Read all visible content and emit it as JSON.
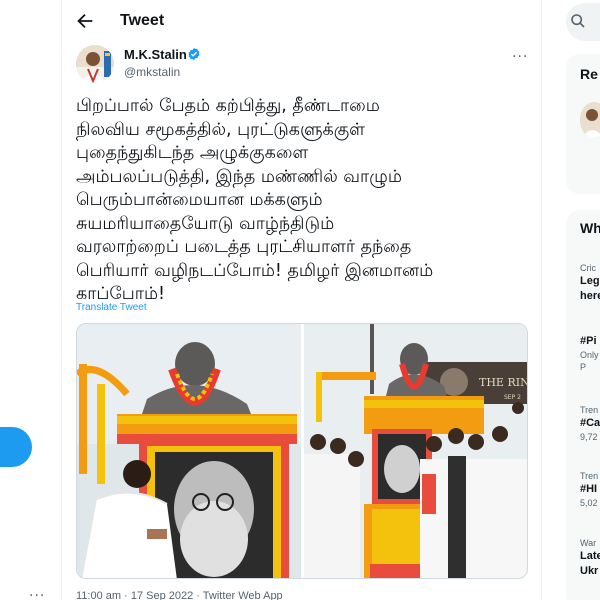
{
  "header": {
    "title": "Tweet"
  },
  "author": {
    "name": "M.K.Stalin",
    "handle": "@mkstalin"
  },
  "tweet": {
    "text": "பிறப்பால் பேதம் கற்பித்து, தீண்டாமை\nநிலவிய சமூகத்தில், புரட்டுகளுக்குள்\nபுதைந்துகிடந்த அழுக்குகளை\nஅம்பலப்படுத்தி, இந்த மண்ணில் வாழும்\nபெரும்பான்மையான மக்களும்\nசுயமரியாதையோடு வாழ்ந்திடும்\nவரலாற்றைப் படைத்த புரட்சியாளர் தந்தை\nபெரியார் வழிநடப்போம்! தமிழர் இனமானம்\nகாப்போம்!",
    "translate": "Translate Tweet",
    "timestamp": "11:00 am · 17 Sep 2022 · Twitter Web App"
  },
  "media": {
    "billboard_text": "THE RINGS",
    "billboard_sub": "SEP 2"
  },
  "sidebar": {
    "relevant_title": "Re",
    "trends_title": "Wh",
    "trends": [
      {
        "meta": "Cric",
        "name": "Leg",
        "name2": "here",
        "count": ""
      },
      {
        "meta": "",
        "name": "#Pi",
        "name2": "Only",
        "count": "P"
      },
      {
        "meta": "Tren",
        "name": "#Ca",
        "name2": "",
        "count": "9,72"
      },
      {
        "meta": "Tren",
        "name": "#HI",
        "name2": "",
        "count": "5,02"
      },
      {
        "meta": "War",
        "name": "Late",
        "name2": "Ukr",
        "count": ""
      }
    ]
  },
  "colors": {
    "accent": "#1d9bf0",
    "text": "#0f1419",
    "muted": "#536471"
  },
  "icons": {
    "back": "arrow-left-icon",
    "verified": "verified-badge-icon",
    "more": "more-dots-icon",
    "search": "search-icon"
  }
}
